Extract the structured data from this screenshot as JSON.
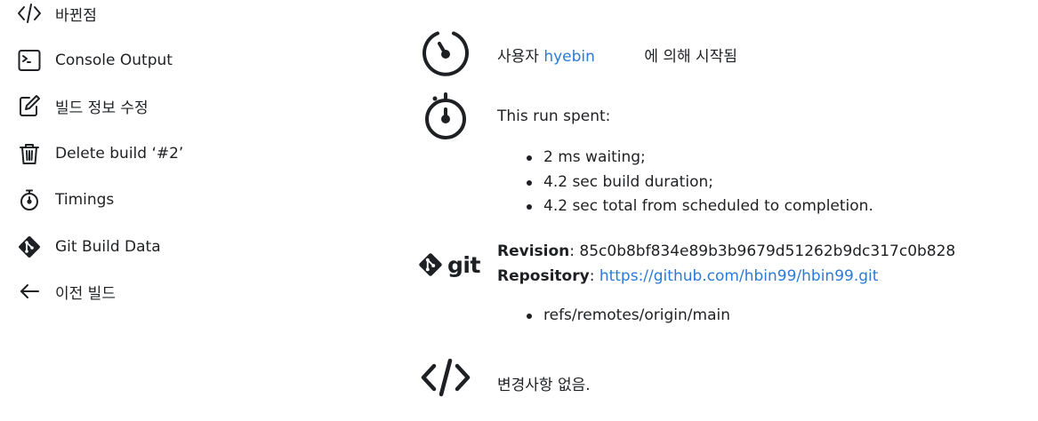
{
  "sidebar": {
    "items": [
      {
        "label": "바뀐점",
        "icon": "code-icon"
      },
      {
        "label": "Console Output",
        "icon": "terminal-icon"
      },
      {
        "label": "빌드 정보 수정",
        "icon": "edit-icon"
      },
      {
        "label": "Delete build ‘#2’",
        "icon": "trash-icon"
      },
      {
        "label": "Timings",
        "icon": "stopwatch-icon"
      },
      {
        "label": "Git Build Data",
        "icon": "git-icon"
      },
      {
        "label": "이전 빌드",
        "icon": "arrow-left-icon"
      }
    ]
  },
  "main": {
    "started": {
      "prefix": "사용자",
      "user": "hyebin",
      "suffix": "에 의해 시작됨"
    },
    "timing": {
      "title": "This run spent:",
      "items": [
        "2 ms waiting;",
        "4.2 sec build duration;",
        "4.2 sec total from scheduled to completion."
      ]
    },
    "git": {
      "logo_text": "git",
      "revision_label": "Revision",
      "revision": "85c0b8bf834e89b3b9679d51262b9dc317c0b828",
      "repository_label": "Repository",
      "repository": "https://github.com/hbin99/hbin99.git",
      "branches": [
        "refs/remotes/origin/main"
      ]
    },
    "changes": {
      "text": "변경사항 없음."
    }
  },
  "colors": {
    "text": "#1f2023",
    "link": "#2a7bd6",
    "background": "#ffffff"
  }
}
